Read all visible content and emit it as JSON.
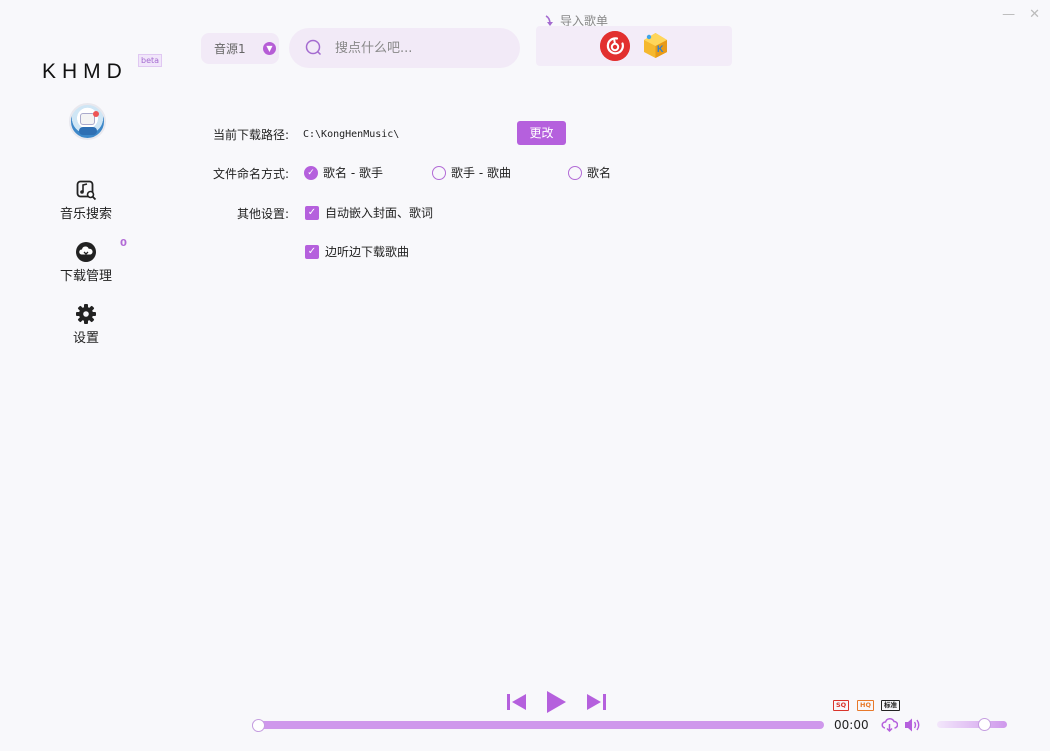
{
  "window": {
    "minimize_glyph": "—",
    "close_glyph": "✕"
  },
  "app": {
    "logo_text": "KHMD",
    "version_tag": "beta"
  },
  "sidebar": {
    "items": [
      {
        "label": "音乐搜索",
        "icon": "music-search-icon"
      },
      {
        "label": "下载管理",
        "icon": "download-cloud-icon"
      },
      {
        "label": "设置",
        "icon": "gear-icon"
      }
    ],
    "download_count": "0"
  },
  "topbar": {
    "source_label": "音源1",
    "search_placeholder": "搜点什么吧...",
    "import_label": "导入歌单",
    "platforms": [
      "netease-cloud-music-icon",
      "kugou-icon"
    ]
  },
  "settings": {
    "path_label": "当前下载路径:",
    "path_value": "C:\\KongHenMusic\\",
    "change_button": "更改",
    "naming_label": "文件命名方式:",
    "naming_options": [
      "歌名 - 歌手",
      "歌手 - 歌曲",
      "歌名"
    ],
    "naming_selected": 0,
    "other_label": "其他设置:",
    "checkboxes": [
      "自动嵌入封面、歌词",
      "边听边下载歌曲"
    ]
  },
  "player": {
    "time": "00:00",
    "progress": 0,
    "volume": 0.72,
    "quality_badges": [
      "SQ",
      "HQ",
      "标准"
    ]
  },
  "colors": {
    "accent": "#b560dd",
    "accent_light": "#cf98ec",
    "panel": "#f2eaf7"
  }
}
